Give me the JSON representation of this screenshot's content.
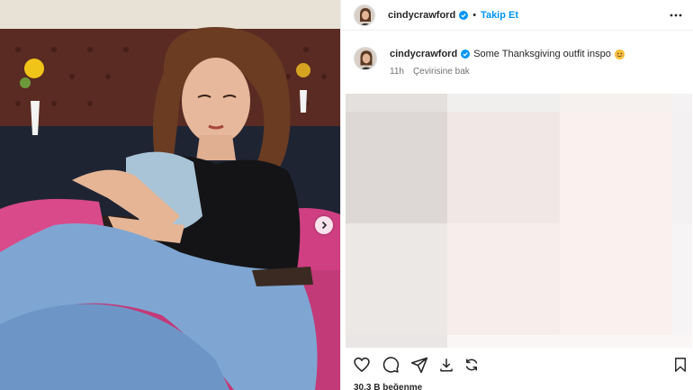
{
  "post": {
    "username": "cindycrawford",
    "separator": "•",
    "follow_label": "Takip Et",
    "caption_text": "Some Thanksgiving outfit inspo",
    "caption_emoji": "smiling-face-with-hearts-emoji",
    "time_ago": "11h",
    "see_translation": "Çevirisine bak",
    "likes_partial": "30.3 B beğenme"
  },
  "icons": {
    "verified": "verified-badge-icon",
    "more": "more-options-icon",
    "next": "chevron-right-icon",
    "like": "heart-icon",
    "comment": "comment-icon",
    "share": "paper-plane-icon",
    "download": "download-icon",
    "repost": "repost-icon",
    "save": "bookmark-icon"
  },
  "colors": {
    "accent": "#0095f6",
    "verified": "#0095f6",
    "text": "#262626",
    "muted": "#737373"
  }
}
